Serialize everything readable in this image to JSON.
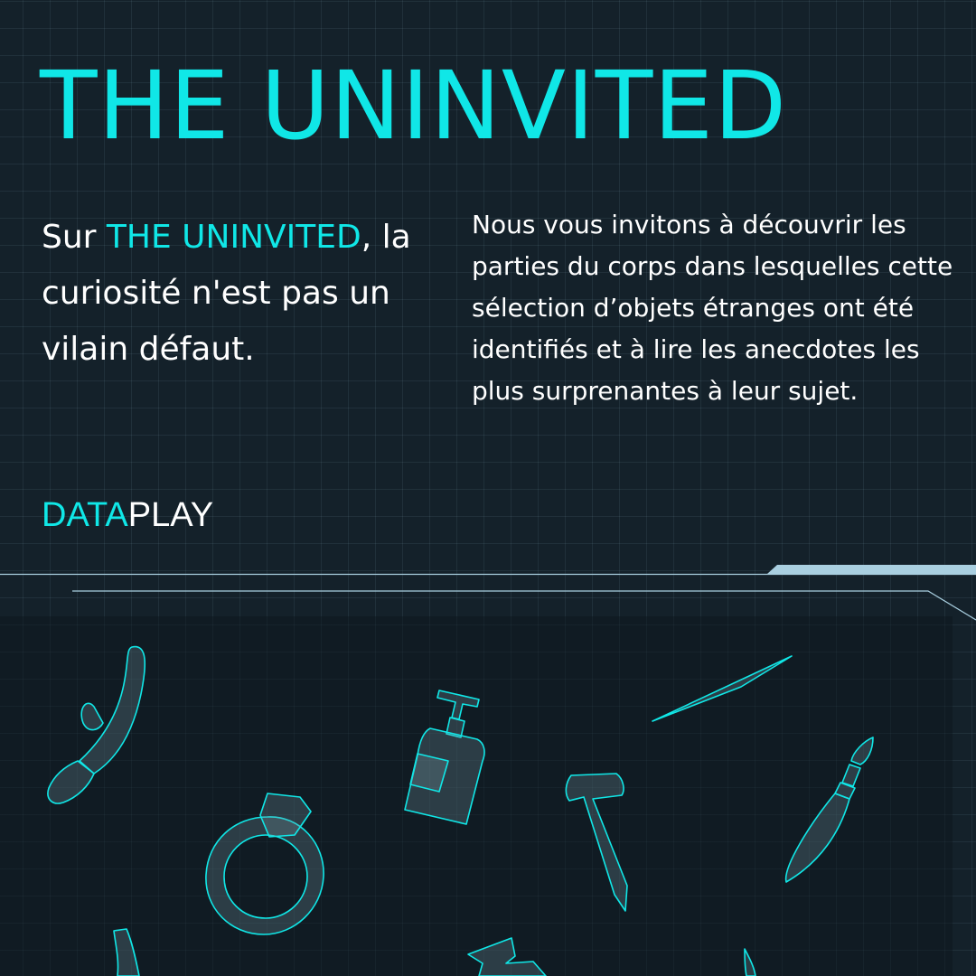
{
  "header": {
    "title": "THE UNINVITED"
  },
  "intro": {
    "prefix": "Sur ",
    "highlight": "THE UNINVITED",
    "suffix": ", la curiosité n'est pas un vilain défaut."
  },
  "description": "Nous vous invitons à découvrir les parties du corps dans lesquelles cette sélection d’objets étranges ont été identifiés et à lire les anecdotes les plus surprenantes à leur sujet.",
  "brand": {
    "part1": "DATA",
    "part2": "PLAY"
  },
  "objects": [
    "vibrator-icon",
    "ring-icon",
    "lotion-bottle-icon",
    "toothpick-icon",
    "nail-icon",
    "paintbrush-icon"
  ],
  "colors": {
    "accent": "#10e7e7",
    "background": "#14212a",
    "divider": "#a9cfe0"
  }
}
